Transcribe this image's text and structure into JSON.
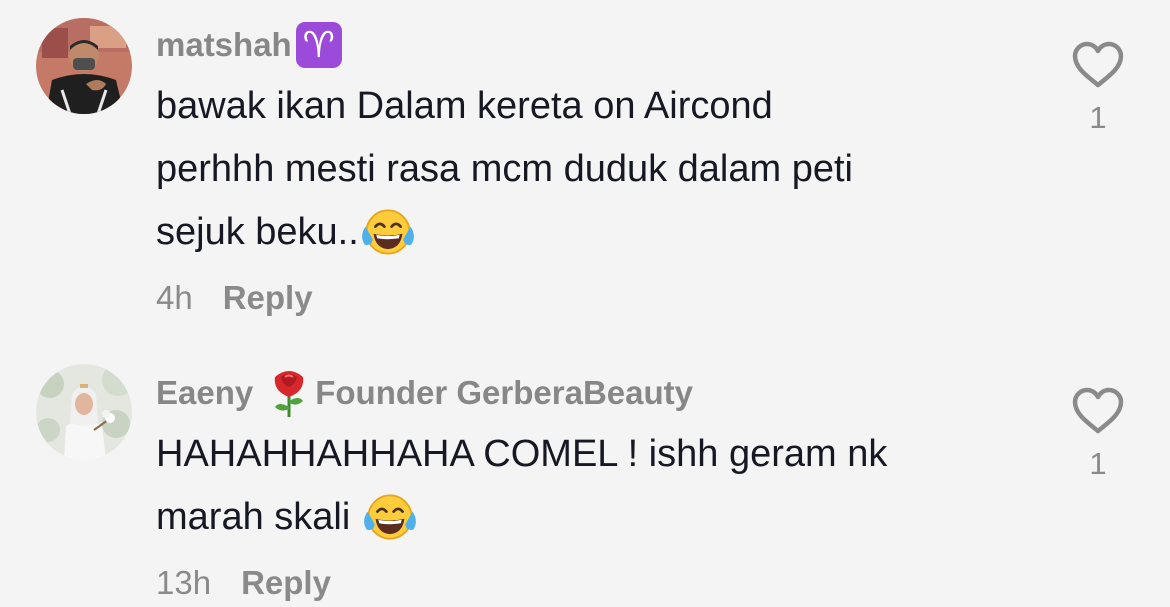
{
  "comments": [
    {
      "username": "matshah",
      "badge": "♈",
      "lines": [
        "bawak ikan Dalam kereta on Aircond",
        "perhhh mesti rasa mcm duduk dalam peti",
        "sejuk beku.."
      ],
      "emoji": "face-with-tears-of-joy-icon",
      "time": "4h",
      "reply_label": "Reply",
      "likes": "1"
    },
    {
      "username": "Eaeny",
      "icon": "rose-icon",
      "username_suffix": "Founder GerberaBeauty",
      "lines": [
        "HAHAHHAHHAHA COMEL ! ishh geram nk",
        "marah skali "
      ],
      "emoji": "face-with-tears-of-joy-icon",
      "time": "13h",
      "reply_label": "Reply",
      "likes": "1"
    }
  ],
  "colors": {
    "background": "#f4f4f4",
    "username": "#878787",
    "text": "#161823",
    "secondary": "#8a8a8a",
    "badge": "#9b4ad9"
  }
}
